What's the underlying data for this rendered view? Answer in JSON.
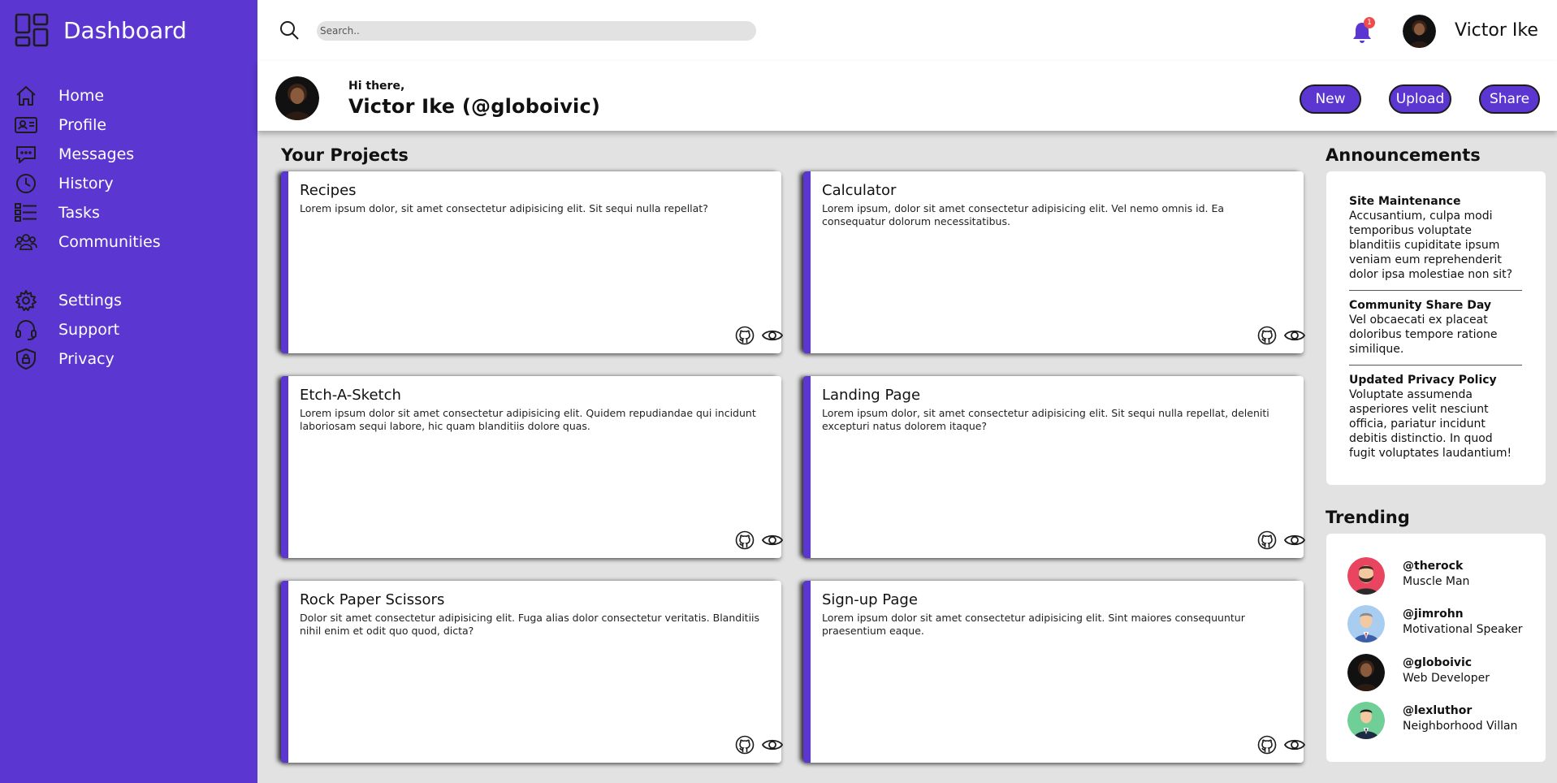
{
  "brand": {
    "title": "Dashboard",
    "icon": "dashboard-grid-icon"
  },
  "sidebar": {
    "items": [
      {
        "label": "Home",
        "icon": "home-icon"
      },
      {
        "label": "Profile",
        "icon": "id-card-icon"
      },
      {
        "label": "Messages",
        "icon": "chat-icon"
      },
      {
        "label": "History",
        "icon": "clock-icon"
      },
      {
        "label": "Tasks",
        "icon": "task-list-icon"
      },
      {
        "label": "Communities",
        "icon": "people-icon"
      }
    ],
    "secondary": [
      {
        "label": "Settings",
        "icon": "gear-icon"
      },
      {
        "label": "Support",
        "icon": "headset-icon"
      },
      {
        "label": "Privacy",
        "icon": "shield-lock-icon"
      }
    ]
  },
  "topbar": {
    "search_placeholder": "Search..",
    "notification_count": "1",
    "username": "Victor Ike"
  },
  "header": {
    "greeting": "Hi there,",
    "name": "Victor Ike (@globoivic)",
    "buttons": {
      "new": "New",
      "upload": "Upload",
      "share": "Share"
    }
  },
  "projects": {
    "title": "Your Projects",
    "items": [
      {
        "title": "Recipes",
        "desc": "Lorem ipsum dolor, sit amet consectetur adipisicing elit. Sit sequi nulla repellat?"
      },
      {
        "title": "Calculator",
        "desc": "Lorem ipsum, dolor sit amet consectetur adipisicing elit. Vel nemo omnis id. Ea consequatur dolorum necessitatibus."
      },
      {
        "title": "Etch-A-Sketch",
        "desc": "Lorem ipsum dolor sit amet consectetur adipisicing elit. Quidem repudiandae qui incidunt laboriosam sequi labore, hic quam blanditiis dolore quas."
      },
      {
        "title": "Landing Page",
        "desc": "Lorem ipsum dolor, sit amet consectetur adipisicing elit. Sit sequi nulla repellat, deleniti excepturi natus dolorem itaque?"
      },
      {
        "title": "Rock Paper Scissors",
        "desc": "Dolor sit amet consectetur adipisicing elit. Fuga alias dolor consectetur veritatis. Blanditiis nihil enim et odit quo quod, dicta?"
      },
      {
        "title": "Sign-up Page",
        "desc": "Lorem ipsum dolor sit amet consectetur adipisicing elit. Sint maiores consequuntur praesentium eaque."
      }
    ]
  },
  "announcements": {
    "title": "Announcements",
    "items": [
      {
        "title": "Site Maintenance",
        "body": "Accusantium, culpa modi temporibus voluptate blanditiis cupiditate ipsum veniam eum reprehenderit dolor ipsa molestiae non sit?"
      },
      {
        "title": "Community Share Day",
        "body": "Vel obcaecati ex placeat doloribus tempore ratione similique."
      },
      {
        "title": "Updated Privacy Policy",
        "body": "Voluptate assumenda asperiores velit nesciunt officia, pariatur incidunt debitis distinctio. In quod fugit voluptates laudantium!"
      }
    ]
  },
  "trending": {
    "title": "Trending",
    "items": [
      {
        "handle": "@therock",
        "role": "Muscle Man"
      },
      {
        "handle": "@jimrohn",
        "role": "Motivational Speaker"
      },
      {
        "handle": "@globoivic",
        "role": "Web Developer"
      },
      {
        "handle": "@lexluthor",
        "role": "Neighborhood Villan"
      }
    ]
  },
  "colors": {
    "accent": "#5b36d1",
    "background": "#e2e2e2",
    "badge": "#f04b4b"
  }
}
